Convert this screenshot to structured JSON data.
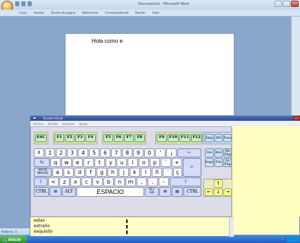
{
  "word": {
    "title": "Documento1 - Microsoft Word",
    "ribbon_tabs": [
      "Inicio",
      "Insertar",
      "Diseño de página",
      "Referencias",
      "Correspondencia",
      "Revisar",
      "Vista"
    ],
    "document_text": "Hola como e",
    "status_words": "Palabras: 3"
  },
  "taskbar": {
    "start_label": "Inicio"
  },
  "keyboard": {
    "title": "Teclado Virtual",
    "menu": [
      "Archivo",
      "Teclado",
      "Opciones",
      "Ayuda"
    ],
    "esc": "ESC",
    "f1_4": [
      "F1",
      "F2",
      "F3",
      "F4"
    ],
    "f5_8": [
      "F5",
      "F6",
      "F7",
      "F8"
    ],
    "f9_12": [
      "F9",
      "F10",
      "F11",
      "F12"
    ],
    "sys": [
      "Imp",
      "BD",
      "Paus"
    ],
    "row1": [
      "ª",
      "1",
      "2",
      "3",
      "4",
      "5",
      "6",
      "7",
      "8",
      "9",
      "0",
      "'",
      "¡"
    ],
    "backspace": "←",
    "row2": [
      "q",
      "w",
      "e",
      "r",
      "t",
      "y",
      "u",
      "i",
      "o",
      "p",
      "`",
      "+"
    ],
    "enter": "↵",
    "caps_line1": "BLOQ",
    "caps_line2": "MAYÚS",
    "row3": [
      "a",
      "s",
      "d",
      "f",
      "g",
      "h",
      "j",
      "k",
      "l",
      "ñ",
      "´",
      "ç"
    ],
    "row4": [
      "<",
      "z",
      "x",
      "c",
      "v",
      "b",
      "n",
      "m",
      ",",
      ".",
      "-"
    ],
    "ctrl": "CTRL",
    "alt": "ALT",
    "space": "ESPACIO",
    "altgr_line1": "ALT",
    "altgr_line2": "GR",
    "nav_top": [
      "Ins",
      "Inic"
    ],
    "pgup_line1": "Re",
    "pgup_line2": "Pág",
    "nav_bottom": [
      "Supr",
      "Fin"
    ],
    "pgdn_line1": "Av",
    "pgdn_line2": "Pág",
    "suggestions": [
      "estas",
      "extraño",
      "exquisito"
    ]
  }
}
